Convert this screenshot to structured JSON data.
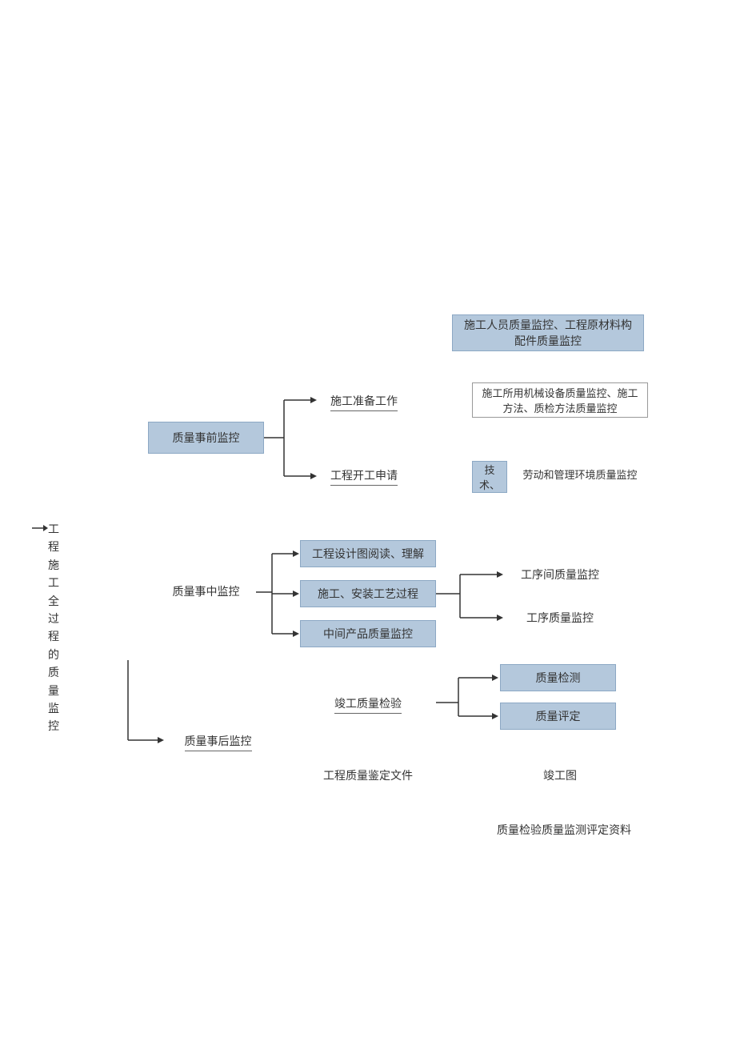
{
  "root": "工程施工全过程的质量监控",
  "pre": {
    "label": "质量事前监控",
    "children": {
      "prep": "施工准备工作",
      "start": "工程开工申请"
    },
    "right": {
      "personnel": "施工人员质量监控、工程原材料构配件质量监控",
      "machinery": "施工所用机械设备质量监控、施工方法、质检方法质量监控",
      "tech": "技术、",
      "labor": "劳动和管理环境质量监控"
    }
  },
  "mid": {
    "label": "质量事中监控",
    "children": {
      "drawing": "工程设计图阅读、理解",
      "process": "施工、安装工艺过程",
      "intermediate": "中间产品质量监控"
    },
    "right": {
      "inter": "工序间质量监控",
      "proc": "工序质量监控"
    }
  },
  "post": {
    "label": "质量事后监控",
    "children": {
      "completion": "竣工质量检验",
      "doc": "工程质量鉴定文件"
    },
    "right": {
      "test": "质量检测",
      "eval": "质量评定",
      "asbuilt": "竣工图",
      "materials": "质量检验质量监测评定资料"
    }
  }
}
